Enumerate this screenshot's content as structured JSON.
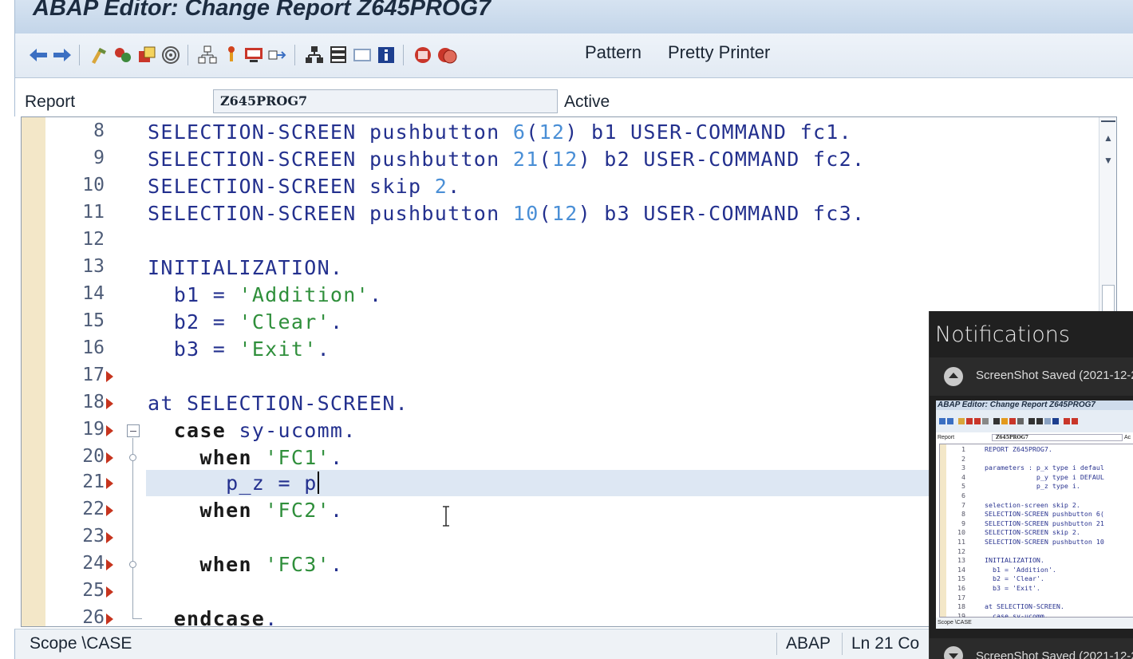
{
  "window": {
    "title": "ABAP Editor: Change Report Z645PROG7"
  },
  "toolbar": {
    "pattern_label": "Pattern",
    "pretty_printer_label": "Pretty Printer",
    "icons": [
      "back-arrow-icon",
      "forward-arrow-icon",
      "check-syntax-icon",
      "activate-icon",
      "test-icon",
      "where-used-icon",
      "object-list-icon",
      "breakpoint-icon",
      "display-object-icon",
      "navigate-icon",
      "hierarchy-icon",
      "stack-icon",
      "fullscreen-icon",
      "info-icon",
      "find-icon",
      "replace-icon"
    ]
  },
  "report": {
    "label": "Report",
    "name": "Z645PROG7",
    "status": "Active"
  },
  "editor": {
    "current_line": 21,
    "lines": [
      {
        "num": "8"
      },
      {
        "num": "9"
      },
      {
        "num": "10"
      },
      {
        "num": "11"
      },
      {
        "num": "12"
      },
      {
        "num": "13"
      },
      {
        "num": "14"
      },
      {
        "num": "15"
      },
      {
        "num": "16"
      },
      {
        "num": "17"
      },
      {
        "num": "18"
      },
      {
        "num": "19"
      },
      {
        "num": "20"
      },
      {
        "num": "21"
      },
      {
        "num": "22"
      },
      {
        "num": "23"
      },
      {
        "num": "24"
      },
      {
        "num": "25"
      },
      {
        "num": "26"
      }
    ],
    "code": {
      "l8": [
        "SELECTION-SCREEN pushbutton ",
        "6",
        "(",
        "12",
        ") b1 USER-COMMAND fc1."
      ],
      "l9": [
        "SELECTION-SCREEN pushbutton ",
        "21",
        "(",
        "12",
        ") b2 USER-COMMAND fc2."
      ],
      "l10": [
        "SELECTION-SCREEN skip ",
        "2",
        "."
      ],
      "l11": [
        "SELECTION-SCREEN pushbutton ",
        "10",
        "(",
        "12",
        ") b3 USER-COMMAND fc3."
      ],
      "l13": "INITIALIZATION.",
      "l14": [
        "  b1 = ",
        "'Addition'",
        "."
      ],
      "l15": [
        "  b2 = ",
        "'Clear'",
        "."
      ],
      "l16": [
        "  b3 = ",
        "'Exit'",
        "."
      ],
      "l18": "at SELECTION-SCREEN.",
      "l19": [
        "  ",
        "case",
        " sy-ucomm."
      ],
      "l20": [
        "    ",
        "when",
        " ",
        "'FC1'",
        "."
      ],
      "l21": "      p_z = p",
      "l22": [
        "    ",
        "when",
        " ",
        "'FC2'",
        "."
      ],
      "l24": [
        "    ",
        "when",
        " ",
        "'FC3'",
        "."
      ],
      "l26": [
        "  ",
        "endcase",
        "."
      ]
    }
  },
  "statusbar": {
    "scope": "Scope \\CASE",
    "language": "ABAP",
    "position": "Ln  21 Co"
  },
  "notifications": {
    "title": "Notifications",
    "items": [
      {
        "text": "ScreenShot Saved   (2021-12-2"
      },
      {
        "text": "ScreenShot Saved   (2021-12-2"
      }
    ],
    "thumbnail": {
      "title": "ABAP Editor: Change Report Z645PROG7",
      "report_label": "Report",
      "report_name": "Z645PROG7",
      "status_short": "Ac",
      "scope": "Scope \\CASE",
      "lines": [
        {
          "n": "1",
          "code": "REPORT Z645PROG7."
        },
        {
          "n": "2",
          "code": ""
        },
        {
          "n": "3",
          "code": "parameters : p_x type i defaul"
        },
        {
          "n": "4",
          "code": "             p_y type i DEFAUL"
        },
        {
          "n": "5",
          "code": "             p_z type i."
        },
        {
          "n": "6",
          "code": ""
        },
        {
          "n": "7",
          "code": "selection-screen skip 2."
        },
        {
          "n": "8",
          "code": "SELECTION-SCREEN pushbutton 6("
        },
        {
          "n": "9",
          "code": "SELECTION-SCREEN pushbutton 21"
        },
        {
          "n": "10",
          "code": "SELECTION-SCREEN skip 2."
        },
        {
          "n": "11",
          "code": "SELECTION-SCREEN pushbutton 10"
        },
        {
          "n": "12",
          "code": ""
        },
        {
          "n": "13",
          "code": "INITIALIZATION."
        },
        {
          "n": "14",
          "code": "  b1 = 'Addition'."
        },
        {
          "n": "15",
          "code": "  b2 = 'Clear'."
        },
        {
          "n": "16",
          "code": "  b3 = 'Exit'."
        },
        {
          "n": "17",
          "code": ""
        },
        {
          "n": "18",
          "code": "at SELECTION-SCREEN."
        },
        {
          "n": "19",
          "code": "  case sy-ucomm."
        }
      ]
    }
  }
}
